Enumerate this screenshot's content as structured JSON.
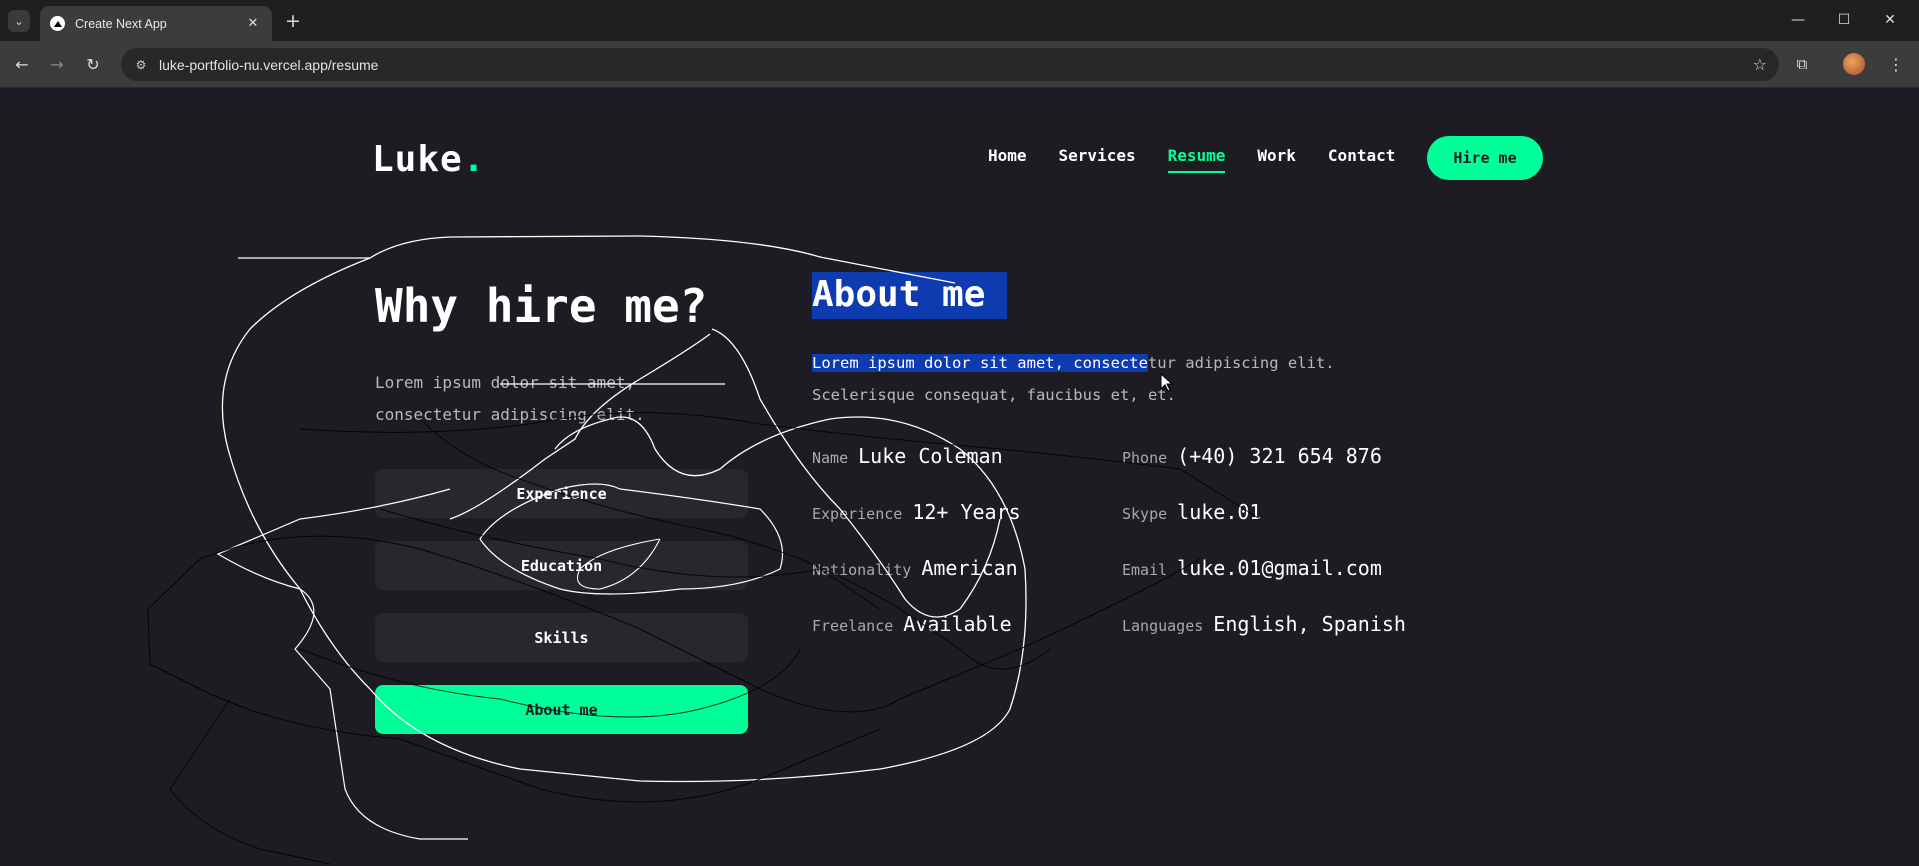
{
  "browser": {
    "tab_title": "Create Next App",
    "url": "luke-portfolio-nu.vercel.app/resume"
  },
  "site": {
    "logo": "Luke",
    "logo_dot": ".",
    "nav": [
      "Home",
      "Services",
      "Resume",
      "Work",
      "Contact"
    ],
    "active_nav": "Resume",
    "hire_button": "Hire me",
    "accent_color": "#00ff99",
    "background_color": "#1c1c22"
  },
  "why": {
    "title": "Why hire me?",
    "description_line1": "Lorem ipsum dolor sit amet,",
    "description_line2": "consectetur adipiscing elit.",
    "tabs": [
      "Experience",
      "Education",
      "Skills",
      "About me"
    ],
    "active_tab": "About me"
  },
  "about": {
    "title": "About me",
    "desc_selected": "Lorem ipsum dolor sit amet, consecte",
    "desc_rest": "tur adipiscing elit.",
    "desc_line2": "Scelerisque consequat, faucibus et, et.",
    "info": [
      {
        "label": "Name",
        "value": "Luke Coleman"
      },
      {
        "label": "Phone",
        "value": "(+40) 321 654 876"
      },
      {
        "label": "Experience",
        "value": "12+ Years"
      },
      {
        "label": "Skype",
        "value": "luke.01"
      },
      {
        "label": "Nationality",
        "value": "American"
      },
      {
        "label": "Email",
        "value": "luke.01@gmail.com"
      },
      {
        "label": "Freelance",
        "value": "Available"
      },
      {
        "label": "Languages",
        "value": "English, Spanish"
      }
    ]
  }
}
